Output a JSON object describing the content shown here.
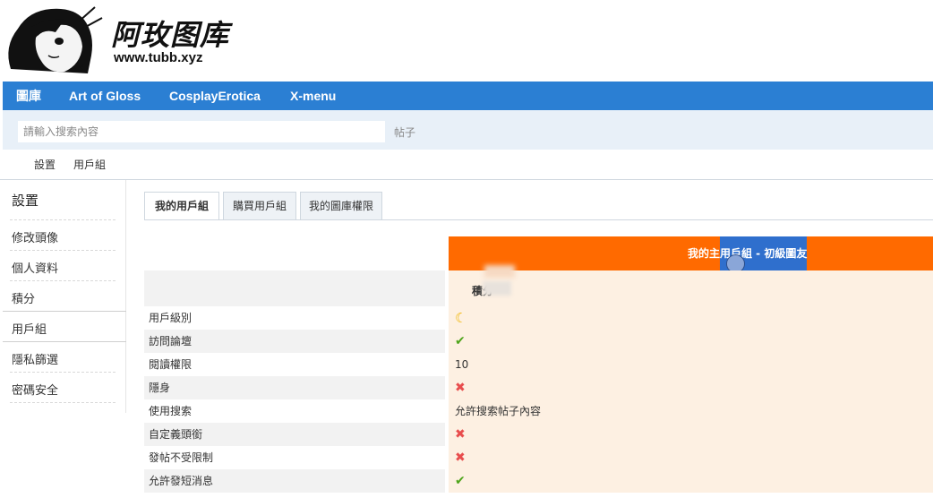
{
  "header": {
    "site_title": "阿玫图库",
    "site_url": "www.tubb.xyz"
  },
  "nav": {
    "items": [
      "圖庫",
      "Art of Gloss",
      "CosplayErotica",
      "X-menu"
    ]
  },
  "search": {
    "placeholder": "請輸入搜索內容",
    "type_label": "帖子"
  },
  "breadcrumb": [
    "設置",
    "用戶組"
  ],
  "sidebar": {
    "title": "設置",
    "items": [
      "修改頭像",
      "個人資料",
      "積分",
      "用戶組",
      "隱私篩選",
      "密碼安全"
    ],
    "active_index": 3
  },
  "tabs": [
    "我的用戶組",
    "購買用戶組",
    "我的圖庫權限"
  ],
  "active_tab": 0,
  "group": {
    "header_title": "我的主用戶組 - 初級圖友",
    "credit_label": "積分"
  },
  "permissions": [
    {
      "label": "用戶級別",
      "icon": "moon-icon",
      "value": ""
    },
    {
      "label": "訪問論壇",
      "icon": "check-icon",
      "value": ""
    },
    {
      "label": "閱讀權限",
      "icon": "",
      "value": "10"
    },
    {
      "label": "隱身",
      "icon": "cross-icon",
      "value": ""
    },
    {
      "label": "使用搜索",
      "icon": "",
      "value": "允許搜索帖子內容"
    },
    {
      "label": "自定義頭銜",
      "icon": "cross-icon",
      "value": ""
    },
    {
      "label": "發帖不受限制",
      "icon": "cross-icon",
      "value": ""
    },
    {
      "label": "允許發短消息",
      "icon": "check-icon",
      "value": ""
    }
  ],
  "colors": {
    "nav_bg": "#2b7fd3",
    "group_header_bg": "#ff6a00",
    "check": "#4fa51c",
    "cross": "#e84d4d"
  }
}
